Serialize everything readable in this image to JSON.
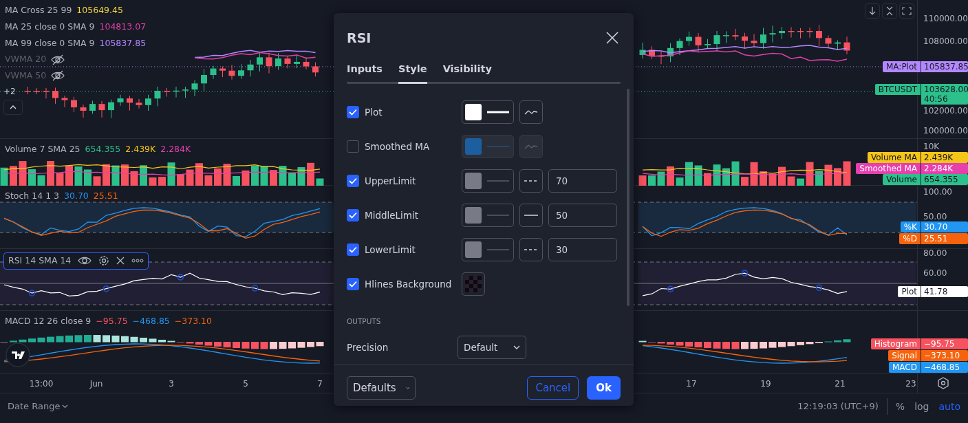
{
  "chart": {
    "panes": [
      {
        "kind": "price",
        "legend": [
          {
            "title": "MA Cross 25 99",
            "visible": true,
            "selected": false,
            "values": [
              {
                "text": "105649.45",
                "color": "#f5d63d"
              }
            ]
          },
          {
            "title": "MA 25 close 0 SMA 9",
            "visible": true,
            "selected": false,
            "values": [
              {
                "text": "104813.07",
                "color": "#e040a8"
              }
            ]
          },
          {
            "title": "MA 99 close 0 SMA 9",
            "visible": true,
            "selected": false,
            "values": [
              {
                "text": "105837.85",
                "color": "#b388ff"
              }
            ]
          },
          {
            "title": "VWMA 20",
            "visible": false,
            "selected": false
          },
          {
            "title": "VWMA 50",
            "visible": false,
            "selected": false
          }
        ],
        "more_count": "+2",
        "ticks": [
          "110000.00",
          "108000.00",
          "102000.00",
          "100000.00"
        ],
        "labels": [
          {
            "name": "MA:Plot",
            "value": "105837.85",
            "color": "#b388ff"
          },
          {
            "name": "BTCUSDT",
            "value": "103628.00",
            "countdown": "40:56",
            "color": "#2cc08b"
          }
        ]
      },
      {
        "kind": "volume",
        "legend": [
          {
            "title": "Volume 7 SMA 25",
            "visible": true,
            "selected": false,
            "values": [
              {
                "text": "654.355",
                "color": "#2cc08b"
              },
              {
                "text": "2.439K",
                "color": "#f5c518"
              },
              {
                "text": "2.284K",
                "color": "#e63fae"
              }
            ]
          }
        ],
        "ticks": [
          "10K"
        ],
        "labels": [
          {
            "name": "Volume MA",
            "value": "2.439K",
            "color": "#f5c518"
          },
          {
            "name": "Smoothed MA",
            "value": "2.284K",
            "color": "#e63fae"
          },
          {
            "name": "Volume",
            "value": "654.355",
            "color": "#2cc08b"
          }
        ]
      },
      {
        "kind": "stoch",
        "legend": [
          {
            "title": "Stoch 14 1 3",
            "visible": true,
            "selected": false,
            "values": [
              {
                "text": "30.70",
                "color": "#2196f3"
              },
              {
                "text": "25.51",
                "color": "#f7630c"
              }
            ]
          }
        ],
        "ticks": [
          "100.00",
          "50.00"
        ],
        "labels": [
          {
            "name": "%K",
            "value": "30.70",
            "color": "#2196f3"
          },
          {
            "name": "%D",
            "value": "25.51",
            "color": "#f7630c"
          }
        ]
      },
      {
        "kind": "rsi",
        "legend": [
          {
            "title": "RSI 14 SMA 14",
            "visible": true,
            "selected": true
          }
        ],
        "ticks": [
          "80.00",
          "60.00"
        ],
        "labels": [
          {
            "name": "Plot",
            "value": "41.78",
            "color": "#ffffff"
          }
        ]
      },
      {
        "kind": "macd",
        "legend": [
          {
            "title": "MACD 12 26 close 9",
            "visible": true,
            "selected": false,
            "values": [
              {
                "text": "−95.75",
                "color": "#f7525f"
              },
              {
                "text": "−468.85",
                "color": "#2196f3"
              },
              {
                "text": "−373.10",
                "color": "#f7630c"
              }
            ]
          }
        ],
        "labels": [
          {
            "name": "Histogram",
            "value": "−95.75",
            "color": "#f7525f"
          },
          {
            "name": "Signal",
            "value": "−373.10",
            "color": "#f7630c"
          },
          {
            "name": "MACD",
            "value": "−468.85",
            "color": "#2196f3"
          }
        ]
      }
    ],
    "time_axis": [
      "13:00",
      "Jun",
      "3",
      "5",
      "7",
      "17",
      "19",
      "21",
      "23"
    ]
  },
  "bottom_bar": {
    "date_range": "Date Range",
    "clock": "12:19:03 (UTC+9)",
    "scale_modes": [
      {
        "label": "%",
        "selected": false
      },
      {
        "label": "log",
        "selected": false
      },
      {
        "label": "auto",
        "selected": true
      }
    ]
  },
  "dialog": {
    "title": "RSI",
    "tabs": [
      {
        "label": "Inputs",
        "selected": false
      },
      {
        "label": "Style",
        "selected": true
      },
      {
        "label": "Visibility",
        "selected": false
      }
    ],
    "rows": [
      {
        "kind": "plot",
        "label": "Plot",
        "checked": true,
        "color": "#ffffff",
        "thick": true
      },
      {
        "kind": "plot",
        "label": "Smoothed MA",
        "checked": false,
        "color": "#1c5fa0",
        "thick": false
      },
      {
        "kind": "hline",
        "label": "UpperLimit",
        "checked": true,
        "color": "#787b86",
        "dashed": true,
        "value": "70"
      },
      {
        "kind": "hline",
        "label": "MiddleLimit",
        "checked": true,
        "color": "#787b86",
        "dashed": false,
        "value": "50"
      },
      {
        "kind": "hline",
        "label": "LowerLimit",
        "checked": true,
        "color": "#787b86",
        "dashed": true,
        "value": "30"
      },
      {
        "kind": "background",
        "label": "Hlines Background",
        "checked": true
      }
    ],
    "section": "OUTPUTS",
    "precision": {
      "label": "Precision",
      "value": "Default"
    },
    "footer": {
      "defaults": "Defaults",
      "cancel": "Cancel",
      "ok": "Ok"
    }
  }
}
